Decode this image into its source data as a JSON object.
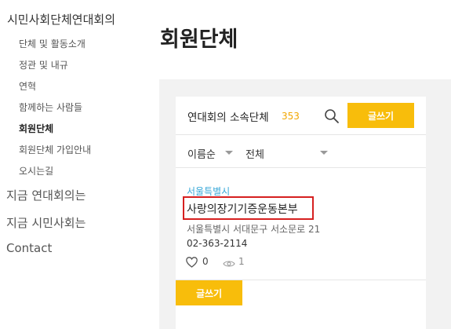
{
  "sidebar": {
    "title": "시민사회단체연대회의",
    "sub_items": [
      {
        "label": "단체 및 활동소개"
      },
      {
        "label": "정관 및 내규"
      },
      {
        "label": "연혁"
      },
      {
        "label": "함께하는 사람들"
      },
      {
        "label": "회원단체",
        "active": true
      },
      {
        "label": "회원단체 가입안내"
      },
      {
        "label": "오시는길"
      }
    ],
    "top_items": [
      {
        "label": "지금 연대회의는"
      },
      {
        "label": "지금 시민사회는"
      },
      {
        "label": "Contact"
      }
    ]
  },
  "page": {
    "title": "회원단체"
  },
  "board": {
    "heading": "연대회의 소속단체",
    "count": "353",
    "write_label": "글쓰기",
    "sort_value": "이름순",
    "category_value": "전체",
    "search_icon": "search-icon"
  },
  "posts": [
    {
      "category": "서울특별시",
      "title": "사랑의장기기증운동본부",
      "address": "서울특별시 서대문구 서소문로 21",
      "phone": "02-363-2114",
      "likes": "0",
      "views": "1",
      "highlighted": true
    }
  ],
  "colors": {
    "accent": "#f8bd0b",
    "count": "#f2a600",
    "category": "#38a8d8",
    "highlight_border": "#d62020",
    "panel_bg": "#f2f2f2"
  }
}
